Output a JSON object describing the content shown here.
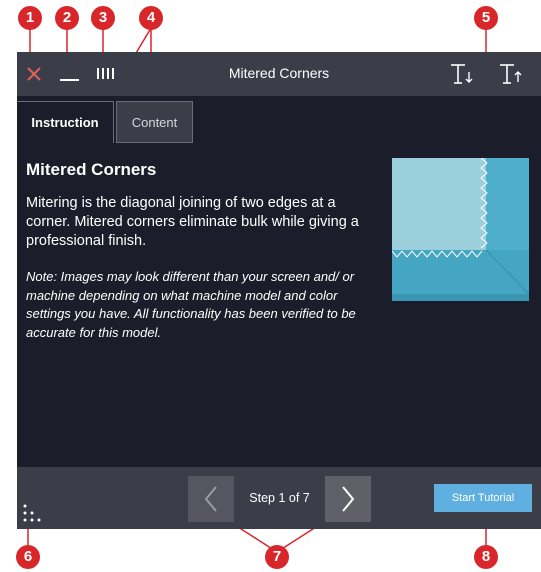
{
  "window": {
    "title": "Mitered Corners"
  },
  "tabs": [
    {
      "label": "Instruction",
      "active": true
    },
    {
      "label": "Content",
      "active": false
    }
  ],
  "content": {
    "heading": "Mitered Corners",
    "paragraph": "Mitering is the diagonal joining of two edges at a corner. Mitered corners eliminate bulk while giving a professional finish.",
    "note": "Note: Images may look different than your screen and/ or machine depending on what machine model and color settings you have. All functionality has been verified to be accurate for this model."
  },
  "footer": {
    "step_label": "Step 1 of 7",
    "start_button": "Start Tutorial"
  },
  "callouts": [
    "1",
    "2",
    "3",
    "4",
    "5",
    "6",
    "7",
    "8"
  ],
  "icons": {
    "close": "close-icon",
    "minimize": "minimize-icon",
    "split": "split-view-icon",
    "font_decrease": "text-size-decrease-icon",
    "font_increase": "text-size-increase-icon",
    "grid": "dot-grid-icon",
    "prev": "chevron-left-icon",
    "next": "chevron-right-icon"
  },
  "colors": {
    "app_background": "#1b1d2a",
    "bar_background": "#3b3d48",
    "close_icon": "#e0605c",
    "start_button": "#5fb0e0",
    "callout": "#d8262a",
    "fabric_light": "#9ccfdc",
    "fabric_dark": "#4eaecb"
  }
}
